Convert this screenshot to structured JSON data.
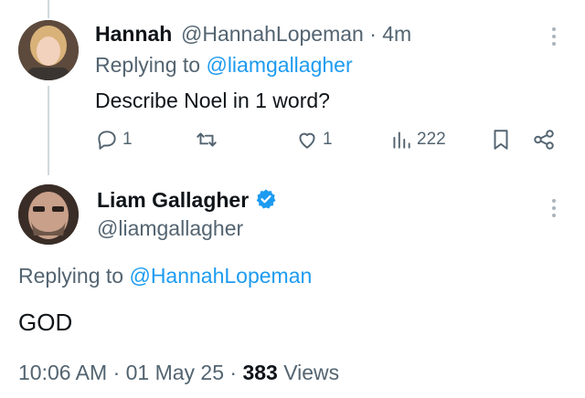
{
  "reply_tweet": {
    "author_name": "Hannah",
    "author_handle": "@HannahLopeman",
    "time_ago": "· 4m",
    "replying_prefix": "Replying to",
    "replying_to": "@liamgallagher",
    "text": "Describe Noel in 1 word?",
    "actions": {
      "replies": "1",
      "retweets": "",
      "likes": "1",
      "views": "222"
    }
  },
  "main_tweet": {
    "author_name": "Liam Gallagher",
    "author_handle": "@liamgallagher",
    "verified": true,
    "replying_prefix": "Replying to",
    "replying_to": "@HannahLopeman",
    "text": "GOD",
    "timestamp": "10:06 AM · 01 May 25 ·",
    "views_count": "383",
    "views_label": "Views"
  },
  "colors": {
    "link": "#1d9bf0",
    "muted": "#536471",
    "verified_badge": "#1d9bf0"
  }
}
